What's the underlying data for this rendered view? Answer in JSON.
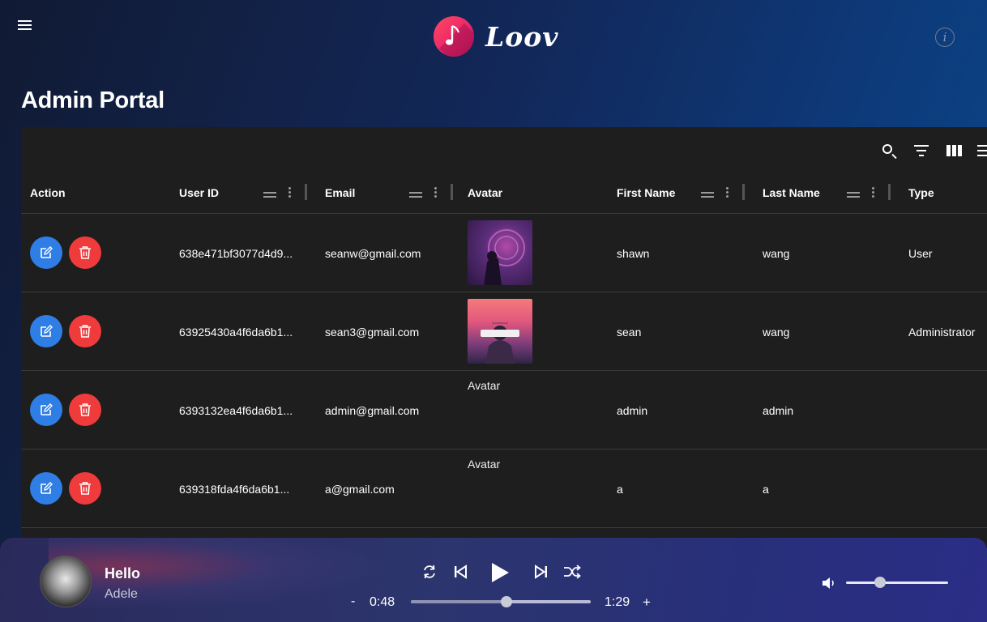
{
  "app": {
    "brand": "Loov",
    "page_title": "Admin Portal"
  },
  "icons": {
    "menu": "menu-icon",
    "logo": "music-note-icon",
    "info": "info-icon",
    "search": "search-icon",
    "filter": "filter-icon",
    "columns": "columns-icon",
    "density": "density-icon",
    "edit": "edit-icon",
    "delete": "trash-icon"
  },
  "colors": {
    "edit": "#2f7ee6",
    "delete": "#ef3b3b",
    "logo": "#e8236b"
  },
  "table": {
    "columns": [
      "Action",
      "User ID",
      "Email",
      "Avatar",
      "First Name",
      "Last Name",
      "Type"
    ],
    "broken_avatar_alt": "Avatar",
    "rows": [
      {
        "user_id": "638e471bf3077d4d9...",
        "email": "seanw@gmail.com",
        "first": "shawn",
        "last": "wang",
        "type": "User"
      },
      {
        "user_id": "63925430a4f6da6b1...",
        "email": "sean3@gmail.com",
        "first": "sean",
        "last": "wang",
        "type": "Administrator"
      },
      {
        "user_id": "6393132ea4f6da6b1...",
        "email": "admin@gmail.com",
        "first": "admin",
        "last": "admin",
        "type": ""
      },
      {
        "user_id": "639318fda4f6da6b1...",
        "email": "a@gmail.com",
        "first": "a",
        "last": "a",
        "type": ""
      }
    ]
  },
  "player": {
    "title": "Hello",
    "artist": "Adele",
    "current_time": "0:48",
    "total_time": "1:29",
    "minus": "-",
    "plus": "+",
    "progress": 0.53,
    "volume": 0.33
  }
}
